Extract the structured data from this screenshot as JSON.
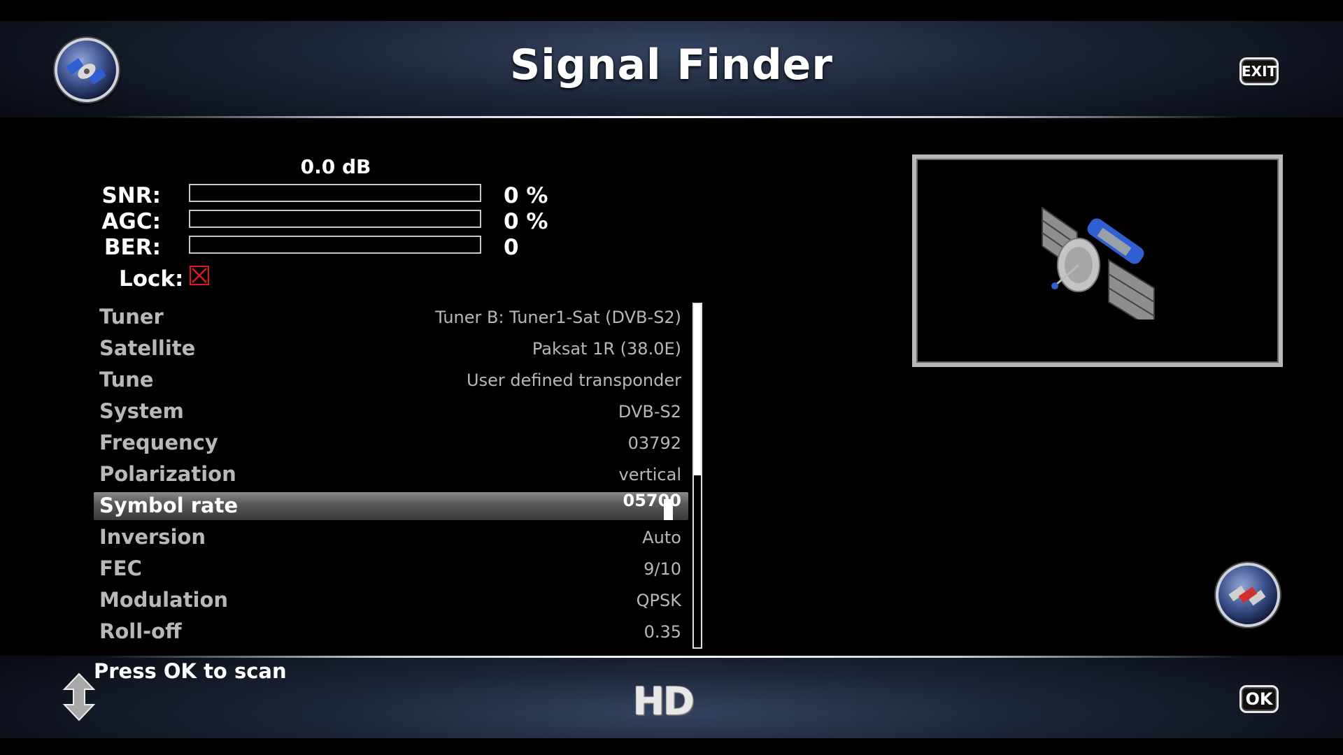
{
  "header": {
    "title": "Signal Finder",
    "exit_label": "EXIT"
  },
  "meter": {
    "db": "0.0 dB",
    "snr": {
      "label": "SNR:",
      "value": "0 %",
      "level": 0
    },
    "agc": {
      "label": "AGC:",
      "value": "0 %",
      "level": 0
    },
    "ber": {
      "label": "BER:",
      "value": "0",
      "level": 0
    },
    "lock_label": "Lock:",
    "locked": false
  },
  "settings": {
    "rows": [
      {
        "label": "Tuner",
        "value": "Tuner B: Tuner1-Sat (DVB-S2)"
      },
      {
        "label": "Satellite",
        "value": "Paksat 1R (38.0E)"
      },
      {
        "label": "Tune",
        "value": "User defined transponder"
      },
      {
        "label": "System",
        "value": "DVB-S2"
      },
      {
        "label": "Frequency",
        "value": "03792"
      },
      {
        "label": "Polarization",
        "value": "vertical"
      },
      {
        "label": "Symbol rate",
        "value": "05700"
      },
      {
        "label": "Inversion",
        "value": "Auto"
      },
      {
        "label": "FEC",
        "value": "9/10"
      },
      {
        "label": "Modulation",
        "value": "QPSK"
      },
      {
        "label": "Roll-off",
        "value": "0.35"
      }
    ],
    "selected_index": 6
  },
  "footer": {
    "hint": "Press OK to scan",
    "hd_label": "HD",
    "ok_label": "OK"
  },
  "icons": {
    "top_left": "satellite-dish-icon",
    "exit": "exit-key-icon",
    "preview": "satellite-icon",
    "bottom_right": "satellite-dish-icon",
    "bottom_left": "up-down-arrows-icon",
    "ok": "ok-key-icon"
  },
  "colors": {
    "lock_fail": "#e01818",
    "selection": "#5a5a5a",
    "label_gray": "#b8b8b8"
  }
}
